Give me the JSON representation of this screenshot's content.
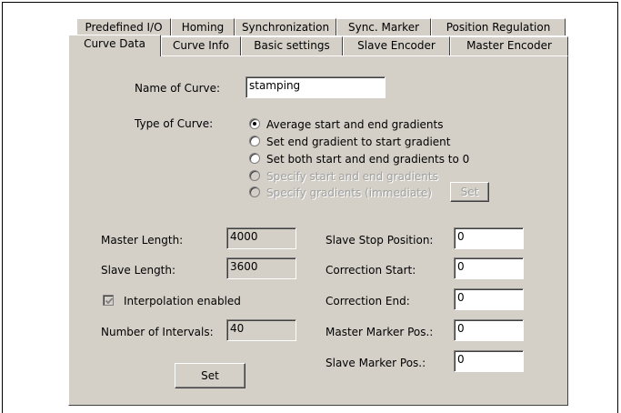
{
  "tabs_row1": [
    "Predefined I/O",
    "Homing",
    "Synchronization",
    "Sync. Marker",
    "Position Regulation"
  ],
  "tabs_row2": [
    "Curve Data",
    "Curve Info",
    "Basic settings",
    "Slave Encoder",
    "Master Encoder"
  ],
  "active_tab": "Curve Data",
  "curve": {
    "name_label": "Name of Curve:",
    "name_value": "stamping",
    "type_label": "Type of Curve:",
    "options": [
      {
        "label": "Average start and end gradients",
        "selected": true,
        "enabled": true
      },
      {
        "label": "Set end gradient to start gradient",
        "selected": false,
        "enabled": true
      },
      {
        "label": "Set both start and end gradients to 0",
        "selected": false,
        "enabled": true
      },
      {
        "label": "Specify start and end gradients",
        "selected": false,
        "enabled": false
      },
      {
        "label": "Specify gradients (immediate)",
        "selected": false,
        "enabled": false
      }
    ],
    "gradient_set_label": "Set"
  },
  "left": {
    "master_length_label": "Master Length:",
    "master_length": "4000",
    "slave_length_label": "Slave Length:",
    "slave_length": "3600",
    "interpolation_label": "Interpolation enabled",
    "interpolation_checked": true,
    "intervals_label": "Number of Intervals:",
    "intervals": "40",
    "set_label": "Set"
  },
  "right": {
    "slave_stop_label": "Slave Stop Position:",
    "slave_stop": "0",
    "corr_start_label": "Correction Start:",
    "corr_start": "0",
    "corr_end_label": "Correction End:",
    "corr_end": "0",
    "master_marker_label": "Master Marker Pos.:",
    "master_marker": "0",
    "slave_marker_label": "Slave Marker Pos.:",
    "slave_marker": "0"
  }
}
